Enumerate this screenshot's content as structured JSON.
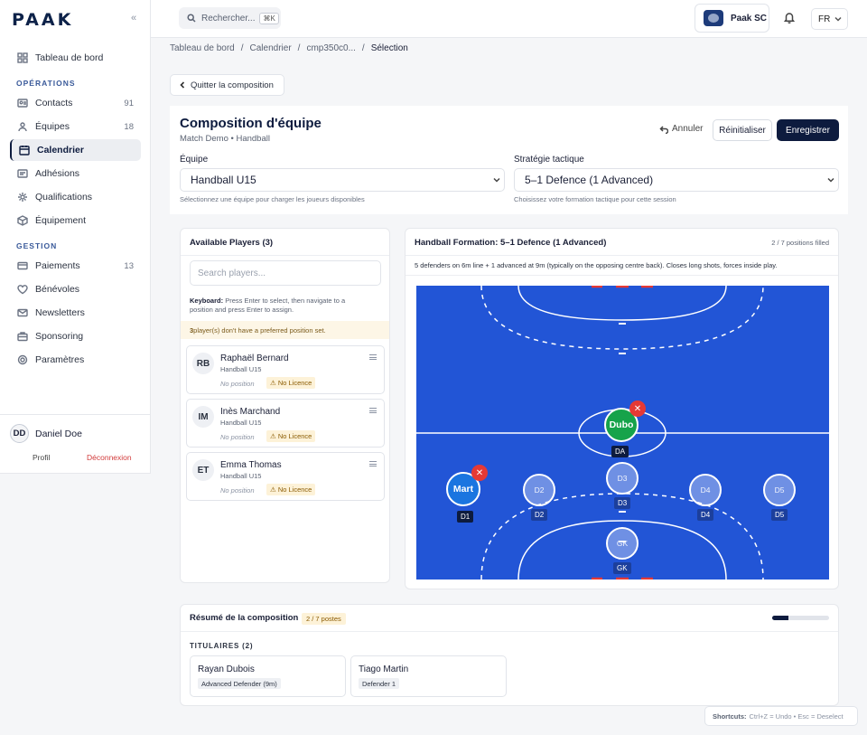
{
  "brand": {
    "logo_text": "PAAK"
  },
  "sidebar": {
    "items_top": [
      {
        "label": "Tableau de bord",
        "icon": "grid-icon"
      }
    ],
    "section_operations": "OPÉRATIONS",
    "items_ops": [
      {
        "label": "Contacts",
        "icon": "contacts-icon",
        "count": "91"
      },
      {
        "label": "Équipes",
        "icon": "team-icon",
        "count": "18"
      },
      {
        "label": "Calendrier",
        "icon": "calendar-icon",
        "count": ""
      },
      {
        "label": "Adhésions",
        "icon": "card-icon",
        "count": ""
      },
      {
        "label": "Qualifications",
        "icon": "cog-icon",
        "count": ""
      },
      {
        "label": "Équipement",
        "icon": "box-icon",
        "count": ""
      }
    ],
    "section_gestion": "GESTION",
    "items_gestion": [
      {
        "label": "Paiements",
        "icon": "payment-icon",
        "count": "13"
      },
      {
        "label": "Bénévoles",
        "icon": "heart-icon",
        "count": ""
      },
      {
        "label": "Newsletters",
        "icon": "mail-icon",
        "count": ""
      },
      {
        "label": "Sponsoring",
        "icon": "briefcase-icon",
        "count": ""
      },
      {
        "label": "Paramètres",
        "icon": "settings-icon",
        "count": ""
      }
    ],
    "user": {
      "initials": "DD",
      "name": "Daniel Doe",
      "profile": "Profil",
      "logout": "Déconnexion"
    }
  },
  "topbar": {
    "search_placeholder": "Rechercher...",
    "search_shortcut": "⌘K",
    "club_name": "Paak SC",
    "language": "FR"
  },
  "breadcrumb": [
    "Tableau de bord",
    "Calendrier",
    "cmp350c0...",
    "Sélection"
  ],
  "quit_label": "Quitter la composition",
  "header": {
    "title": "Composition d'équipe",
    "subtitle": "Match Demo • Handball",
    "undo": "Annuler",
    "reset": "Réinitialiser",
    "save": "Enregistrer",
    "team_label": "Équipe",
    "team_value": "Handball U15",
    "team_help": "Sélectionnez une équipe pour charger les joueurs disponibles",
    "strategy_label": "Stratégie tactique",
    "strategy_value": "5–1 Defence (1 Advanced)",
    "strategy_help": "Choisissez votre formation tactique pour cette session"
  },
  "available": {
    "title": "Available Players (3)",
    "search_placeholder": "Search players...",
    "keyboard_label": "Keyboard:",
    "keyboard_text": "Press Enter to select, then navigate to a position and press Enter to assign.",
    "warning_count": "3",
    "warning_text": "player(s) don't have a preferred position set.",
    "players": [
      {
        "initials": "RB",
        "name": "Raphaël Bernard",
        "team": "Handball U15",
        "position": "No position",
        "licence": "No Licence"
      },
      {
        "initials": "IM",
        "name": "Inès Marchand",
        "team": "Handball U15",
        "position": "No position",
        "licence": "No Licence"
      },
      {
        "initials": "ET",
        "name": "Emma Thomas",
        "team": "Handball U15",
        "position": "No position",
        "licence": "No Licence"
      }
    ]
  },
  "formation": {
    "title": "Handball Formation: 5–1 Defence (1 Advanced)",
    "filled": "2 / 7 positions filled",
    "description": "5 defenders on 6m line + 1 advanced at 9m (typically on the opposing centre back). Closes long shots, forces inside play.",
    "positions": {
      "da": {
        "label": "Dubo",
        "tag": "DA"
      },
      "d1": {
        "label": "Mart",
        "tag": "D1"
      },
      "d2": {
        "label": "D2",
        "tag": "D2"
      },
      "d3": {
        "label": "D3",
        "tag": "D3"
      },
      "d4": {
        "label": "D4",
        "tag": "D4"
      },
      "d5": {
        "label": "D5",
        "tag": "D5"
      },
      "gk": {
        "label": "GK",
        "tag": "GK"
      }
    },
    "remove_symbol": "✕",
    "colors": {
      "court": "#2255d6",
      "filled_blue": "#1a75e0",
      "filled_green": "#16a34a",
      "remove": "#e53935"
    }
  },
  "summary": {
    "title": "Résumé de la composition",
    "count": "2 / 7 postes",
    "progress": 0.2857,
    "section": "TITULAIRES (2)",
    "starters": [
      {
        "name": "Rayan Dubois",
        "role": "Advanced Defender (9m)"
      },
      {
        "name": "Tiago Martin",
        "role": "Defender 1"
      }
    ]
  },
  "shortcuts": {
    "label": "Shortcuts:",
    "text": "Ctrl+Z = Undo • Esc = Deselect"
  }
}
